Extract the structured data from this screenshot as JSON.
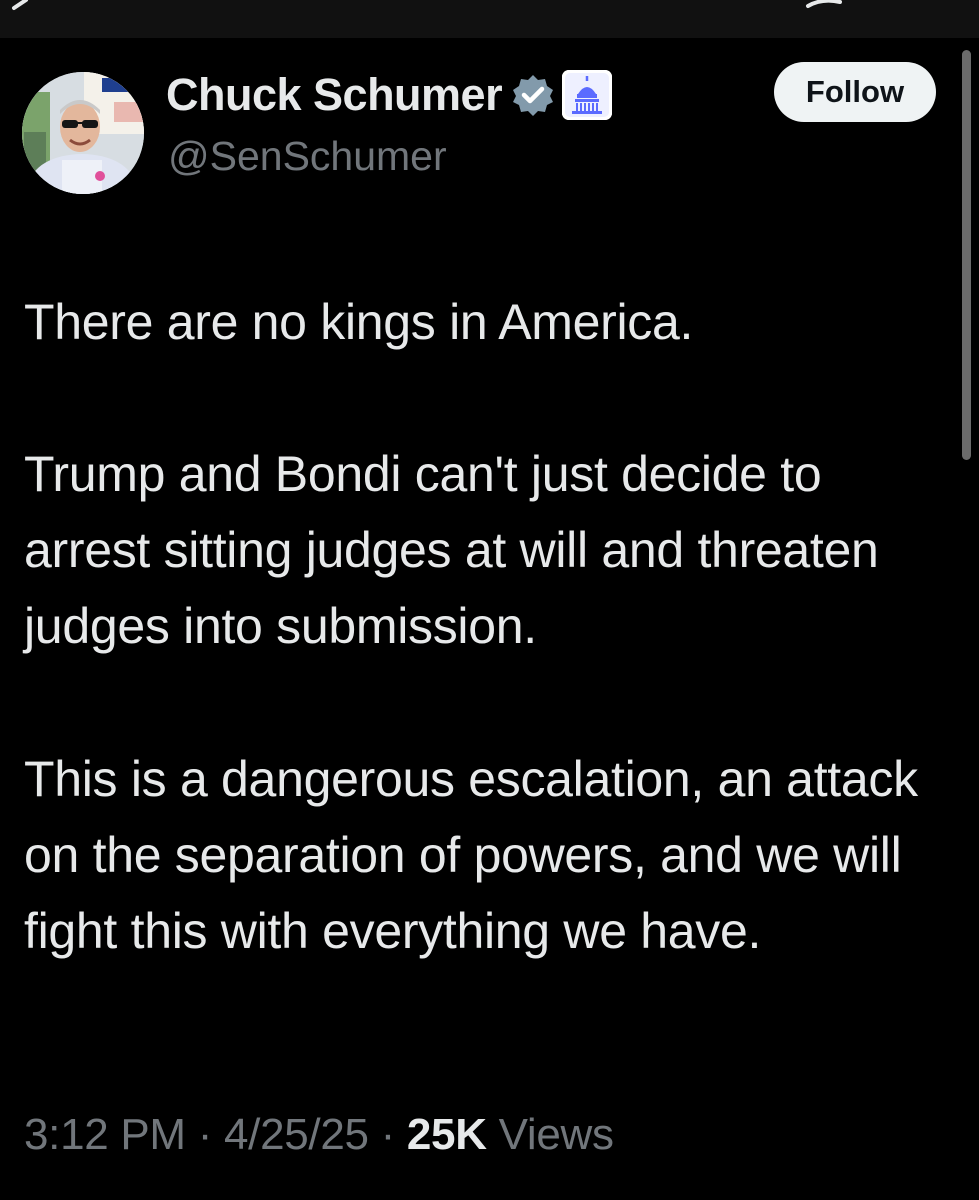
{
  "post": {
    "author": {
      "name": "Chuck Schumer",
      "handle": "@SenSchumer"
    },
    "follow_label": "Follow",
    "text": {
      "p1": "There are no kings in America.",
      "p2": "Trump and Bondi can't just decide to arrest sitting judges at will and threaten judges into submission.",
      "p3": "This is a dangerous escalation, an attack on the separation of powers, and we will fight this with everything we have."
    },
    "meta": {
      "time": "3:12 PM",
      "separator": " · ",
      "date": "4/25/25",
      "views_count": "25K",
      "views_label": " Views"
    }
  },
  "icons": {
    "verified": "verified-badge-icon",
    "government": "capitol-building-icon",
    "back": "chevron-left-icon"
  },
  "colors": {
    "background": "#000000",
    "text_primary": "#e7e9ea",
    "text_secondary": "#71767b",
    "verified_badge": "#829aab",
    "follow_bg": "#eff3f4",
    "gov_badge": "#5b6bff"
  }
}
